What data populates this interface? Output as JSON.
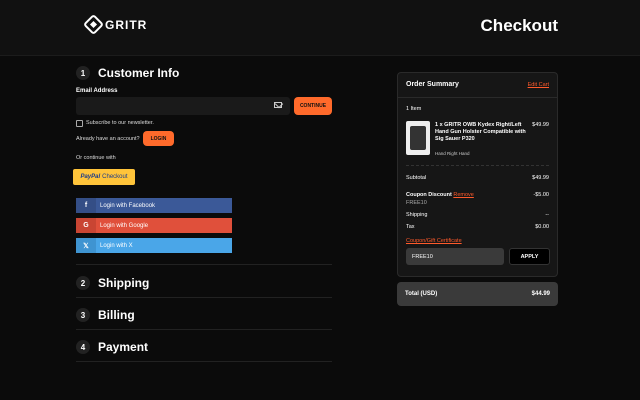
{
  "brand": {
    "name": "GRITR"
  },
  "page_title": "Checkout",
  "steps": [
    {
      "num": "1",
      "title": "Customer Info"
    },
    {
      "num": "2",
      "title": "Shipping"
    },
    {
      "num": "3",
      "title": "Billing"
    },
    {
      "num": "4",
      "title": "Payment"
    }
  ],
  "customer": {
    "email_label": "Email Address",
    "email_value": "",
    "continue_label": "CONTINUE",
    "newsletter_label": "Subscribe to our newsletter.",
    "have_account": "Already have an account?",
    "login_label": "LOGIN",
    "or_continue": "Or continue with",
    "paypal": {
      "brand": "PayPal",
      "text": "Checkout"
    },
    "social": [
      {
        "label": "Login with Facebook",
        "icon": "facebook-icon",
        "glyph": "f",
        "color": "#3b5998",
        "icon_bg": "#344e86"
      },
      {
        "label": "Login with Google",
        "icon": "google-icon",
        "glyph": "G",
        "color": "#e0503b",
        "icon_bg": "#c94533"
      },
      {
        "label": "Login with X",
        "icon": "x-icon",
        "glyph": "𝕏",
        "color": "#4aa6e8",
        "icon_bg": "#3f94d1"
      }
    ]
  },
  "summary": {
    "title": "Order Summary",
    "edit_cart": "Edit Cart",
    "item_count": "1 Item",
    "product": {
      "name": "1 x GRITR OWB Kydex Right/Left Hand Gun Holster Compatible with Sig Sauer P320",
      "variant": "Hand Right Hand",
      "price": "$49.99"
    },
    "subtotal_label": "Subtotal",
    "subtotal_value": "$49.99",
    "discount_label": "Coupon Discount",
    "remove_label": "Remove",
    "discount_value": "-$5.00",
    "discount_code": "FREE10",
    "shipping_label": "Shipping",
    "shipping_value": "--",
    "tax_label": "Tax",
    "tax_value": "$0.00",
    "coupon_link": "Coupon/Gift Certificate",
    "coupon_input": "FREE10",
    "apply_label": "APPLY",
    "total_label": "Total (USD)",
    "total_value": "$44.99"
  },
  "colors": {
    "accent": "#ff6a2b",
    "background": "#0b0b0b",
    "panel": "#161616"
  }
}
